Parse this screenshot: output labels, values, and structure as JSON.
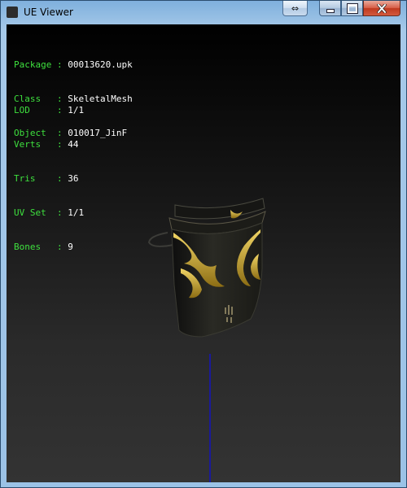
{
  "window": {
    "title": "UE Viewer",
    "buttons": {
      "swap": "⇔"
    }
  },
  "info": {
    "group1": [
      {
        "key": "Package",
        "value": "00013620.upk"
      },
      {
        "key": "Class  ",
        "value": "SkeletalMesh"
      },
      {
        "key": "Object ",
        "value": "010017_JinF"
      }
    ],
    "group2": [
      {
        "key": "LOD    ",
        "value": "1/1"
      },
      {
        "key": "Verts  ",
        "value": "44"
      },
      {
        "key": "Tris   ",
        "value": "36"
      },
      {
        "key": "UV Set ",
        "value": "1/1"
      },
      {
        "key": "Bones  ",
        "value": "9"
      }
    ],
    "separator": " : "
  },
  "colors": {
    "label": "#3ee03e",
    "value": "#ffffff",
    "gold": "#c9a62b",
    "axis": "#1a1a9a"
  }
}
